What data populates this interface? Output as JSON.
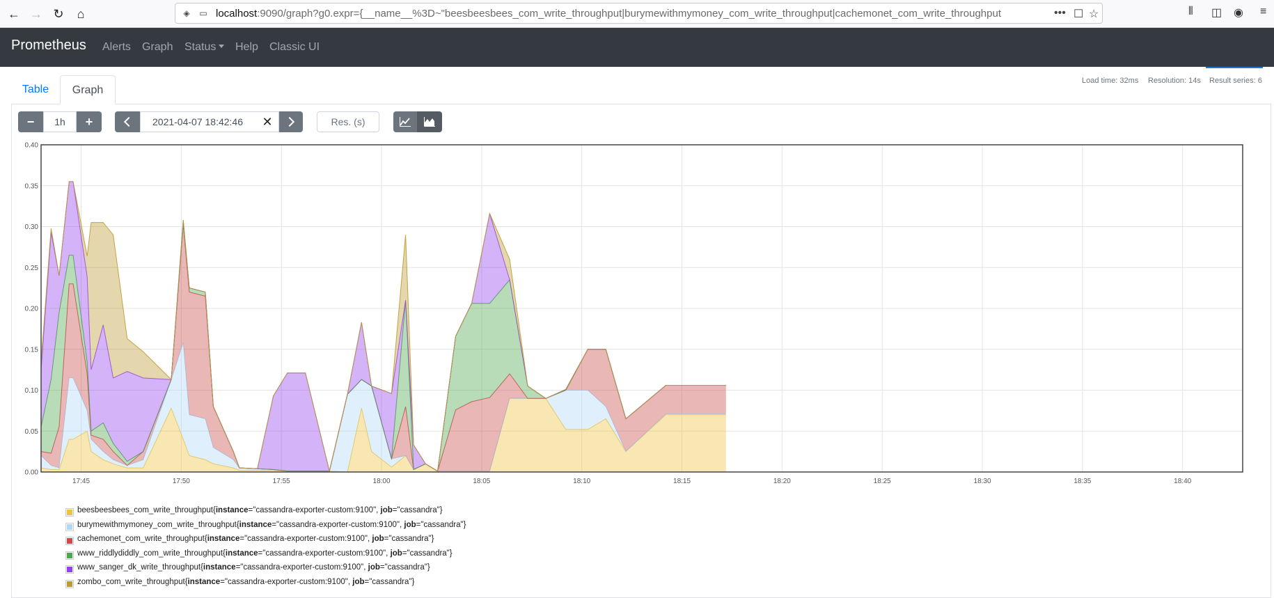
{
  "browser": {
    "url_host": "localhost",
    "url_rest": ":9090/graph?g0.expr={__name__%3D~\"beesbeesbees_com_write_throughput|burymewithmymoney_com_write_throughput|cachemonet_com_write_throughput",
    "menu_glyph": "•••"
  },
  "navbar": {
    "brand": "Prometheus",
    "links": [
      "Alerts",
      "Graph",
      "Status",
      "Help",
      "Classic UI"
    ]
  },
  "tabs": {
    "table": "Table",
    "graph": "Graph"
  },
  "stats": {
    "load_time": "Load time: 32ms",
    "resolution": "Resolution: 14s",
    "result_series": "Result series: 6"
  },
  "controls": {
    "range": "1h",
    "end_time": "2021-04-07 18:42:46",
    "resolution_placeholder": "Res. (s)"
  },
  "chart_data": {
    "type": "area",
    "stacked": true,
    "ylim": [
      0,
      0.4
    ],
    "xlim": [
      43.0,
      103.0
    ],
    "y_ticks": [
      "0.00",
      "0.05",
      "0.10",
      "0.15",
      "0.20",
      "0.25",
      "0.30",
      "0.35",
      "0.40"
    ],
    "x_ticks": [
      {
        "label": "17:45",
        "value": 45
      },
      {
        "label": "17:50",
        "value": 50
      },
      {
        "label": "17:55",
        "value": 55
      },
      {
        "label": "18:00",
        "value": 60
      },
      {
        "label": "18:05",
        "value": 65
      },
      {
        "label": "18:10",
        "value": 70
      },
      {
        "label": "18:15",
        "value": 75
      },
      {
        "label": "18:20",
        "value": 80
      },
      {
        "label": "18:25",
        "value": 85
      },
      {
        "label": "18:30",
        "value": 90
      },
      {
        "label": "18:35",
        "value": 95
      },
      {
        "label": "18:40",
        "value": 100
      }
    ],
    "grid": true,
    "legend_position": "bottom",
    "x": [
      43.0,
      43.5,
      43.9,
      44.4,
      44.6,
      45.3,
      45.5,
      46.1,
      46.6,
      47.3,
      48.1,
      49.5,
      50.1,
      50.4,
      51.2,
      51.6,
      52.6,
      52.9,
      53.8,
      54.6,
      55.3,
      56.2,
      57.4,
      58.3,
      59.0,
      59.5,
      60.5,
      61.2,
      61.6,
      62.2,
      62.8,
      63.7,
      64.5,
      65.4,
      66.4,
      67.3,
      68.2,
      69.2,
      70.3,
      71.2,
      72.2,
      74.2,
      77.2
    ],
    "series": [
      {
        "name": "beesbeesbees_com_write_throughput",
        "instance": "cassandra-exporter-custom:9100",
        "job": "cassandra",
        "color": "#edc240",
        "values": [
          0.005,
          0.003,
          0.003,
          0.04,
          0.04,
          0.05,
          0.025,
          0.015,
          0.01,
          0.005,
          0.005,
          0.078,
          0.04,
          0.02,
          0.015,
          0.01,
          0.005,
          0.002,
          0.002,
          0.002,
          0.001,
          0.001,
          0.001,
          0.0,
          0.078,
          0.025,
          0.006,
          0.02,
          0.003,
          0.01,
          0.001,
          0.001,
          0.001,
          0.001,
          0.09,
          0.09,
          0.09,
          0.052,
          0.052,
          0.065,
          0.025,
          0.07,
          0.07
        ]
      },
      {
        "name": "burymewithmymoney_com_write_throughput",
        "instance": "cassandra-exporter-custom:9100",
        "job": "cassandra",
        "color": "#afd8f8",
        "values": [
          0.015,
          0.005,
          0.002,
          0.075,
          0.075,
          0.025,
          0.015,
          0.01,
          0.005,
          0.003,
          0.01,
          0.035,
          0.118,
          0.05,
          0.05,
          0.02,
          0.01,
          0.003,
          0.002,
          0.001,
          0.0,
          0.0,
          0.0,
          0.095,
          0.035,
          0.08,
          0.01,
          0.0,
          0.0,
          0.0,
          0.0,
          0.0,
          0.0,
          0.0,
          0.0,
          0.0,
          0.0,
          0.048,
          0.048,
          0.015,
          0.0,
          0.001,
          0.001
        ]
      },
      {
        "name": "cachemonet_com_write_throughput",
        "instance": "cassandra-exporter-custom:9100",
        "job": "cassandra",
        "color": "#cb4b4b",
        "values": [
          0.005,
          0.015,
          0.05,
          0.115,
          0.115,
          0.045,
          0.005,
          0.015,
          0.01,
          0.0,
          0.01,
          0.0,
          0.145,
          0.15,
          0.15,
          0.05,
          0.01,
          0.0,
          0.0,
          0.0,
          0.0,
          0.0,
          0.0,
          0.0,
          0.0,
          0.0,
          0.0,
          0.06,
          0.0,
          0.0,
          0.0,
          0.075,
          0.085,
          0.09,
          0.03,
          0.0,
          0.0,
          0.0,
          0.05,
          0.07,
          0.04,
          0.035,
          0.035
        ]
      },
      {
        "name": "www_riddlydiddly_com_write_throughput",
        "instance": "cassandra-exporter-custom:9100",
        "job": "cassandra",
        "color": "#4da74d",
        "values": [
          0.03,
          0.09,
          0.14,
          0.035,
          0.035,
          0.014,
          0.005,
          0.02,
          0.01,
          0.005,
          0.0,
          0.0,
          0.0,
          0.005,
          0.005,
          0.0,
          0.0,
          0.0,
          0.0,
          0.0,
          0.0,
          0.0,
          0.0,
          0.0,
          0.0,
          0.0,
          0.0,
          0.13,
          0.0,
          0.0,
          0.0,
          0.09,
          0.12,
          0.115,
          0.115,
          0.015,
          0.0,
          0.0,
          0.0,
          0.0,
          0.0,
          0.0,
          0.0
        ]
      },
      {
        "name": "www_sanger_dk_write_throughput",
        "instance": "cassandra-exporter-custom:9100",
        "job": "cassandra",
        "color": "#9440ed",
        "values": [
          0.07,
          0.18,
          0.045,
          0.09,
          0.09,
          0.105,
          0.075,
          0.12,
          0.08,
          0.11,
          0.09,
          0.0,
          0.005,
          0.0,
          0.0,
          0.0,
          0.0,
          0.0,
          0.0,
          0.09,
          0.12,
          0.12,
          0.0,
          0.0,
          0.07,
          0.0,
          0.08,
          0.0,
          0.03,
          0.0,
          0.0,
          0.0,
          0.0,
          0.11,
          0.0,
          0.0,
          0.0,
          0.001,
          0.0,
          0.0,
          0.0,
          0.0,
          0.0
        ]
      },
      {
        "name": "zombo_com_write_throughput",
        "instance": "cassandra-exporter-custom:9100",
        "job": "cassandra",
        "color": "#bd9b33",
        "values": [
          0.01,
          0.005,
          0.0,
          0.0,
          0.0,
          0.025,
          0.18,
          0.125,
          0.175,
          0.04,
          0.032,
          0.0,
          0.0,
          0.0,
          0.0,
          0.0,
          0.0,
          0.0,
          0.0,
          0.0,
          0.0,
          0.0,
          0.0,
          0.0,
          0.0,
          0.0,
          0.0,
          0.08,
          0.0,
          0.0,
          0.0,
          0.0,
          0.0,
          0.0,
          0.025,
          0.0,
          0.0,
          0.0,
          0.0,
          0.0,
          0.0,
          0.0,
          0.0
        ]
      }
    ]
  },
  "legend_labels": {
    "instance_key": "instance",
    "job_key": "job"
  }
}
